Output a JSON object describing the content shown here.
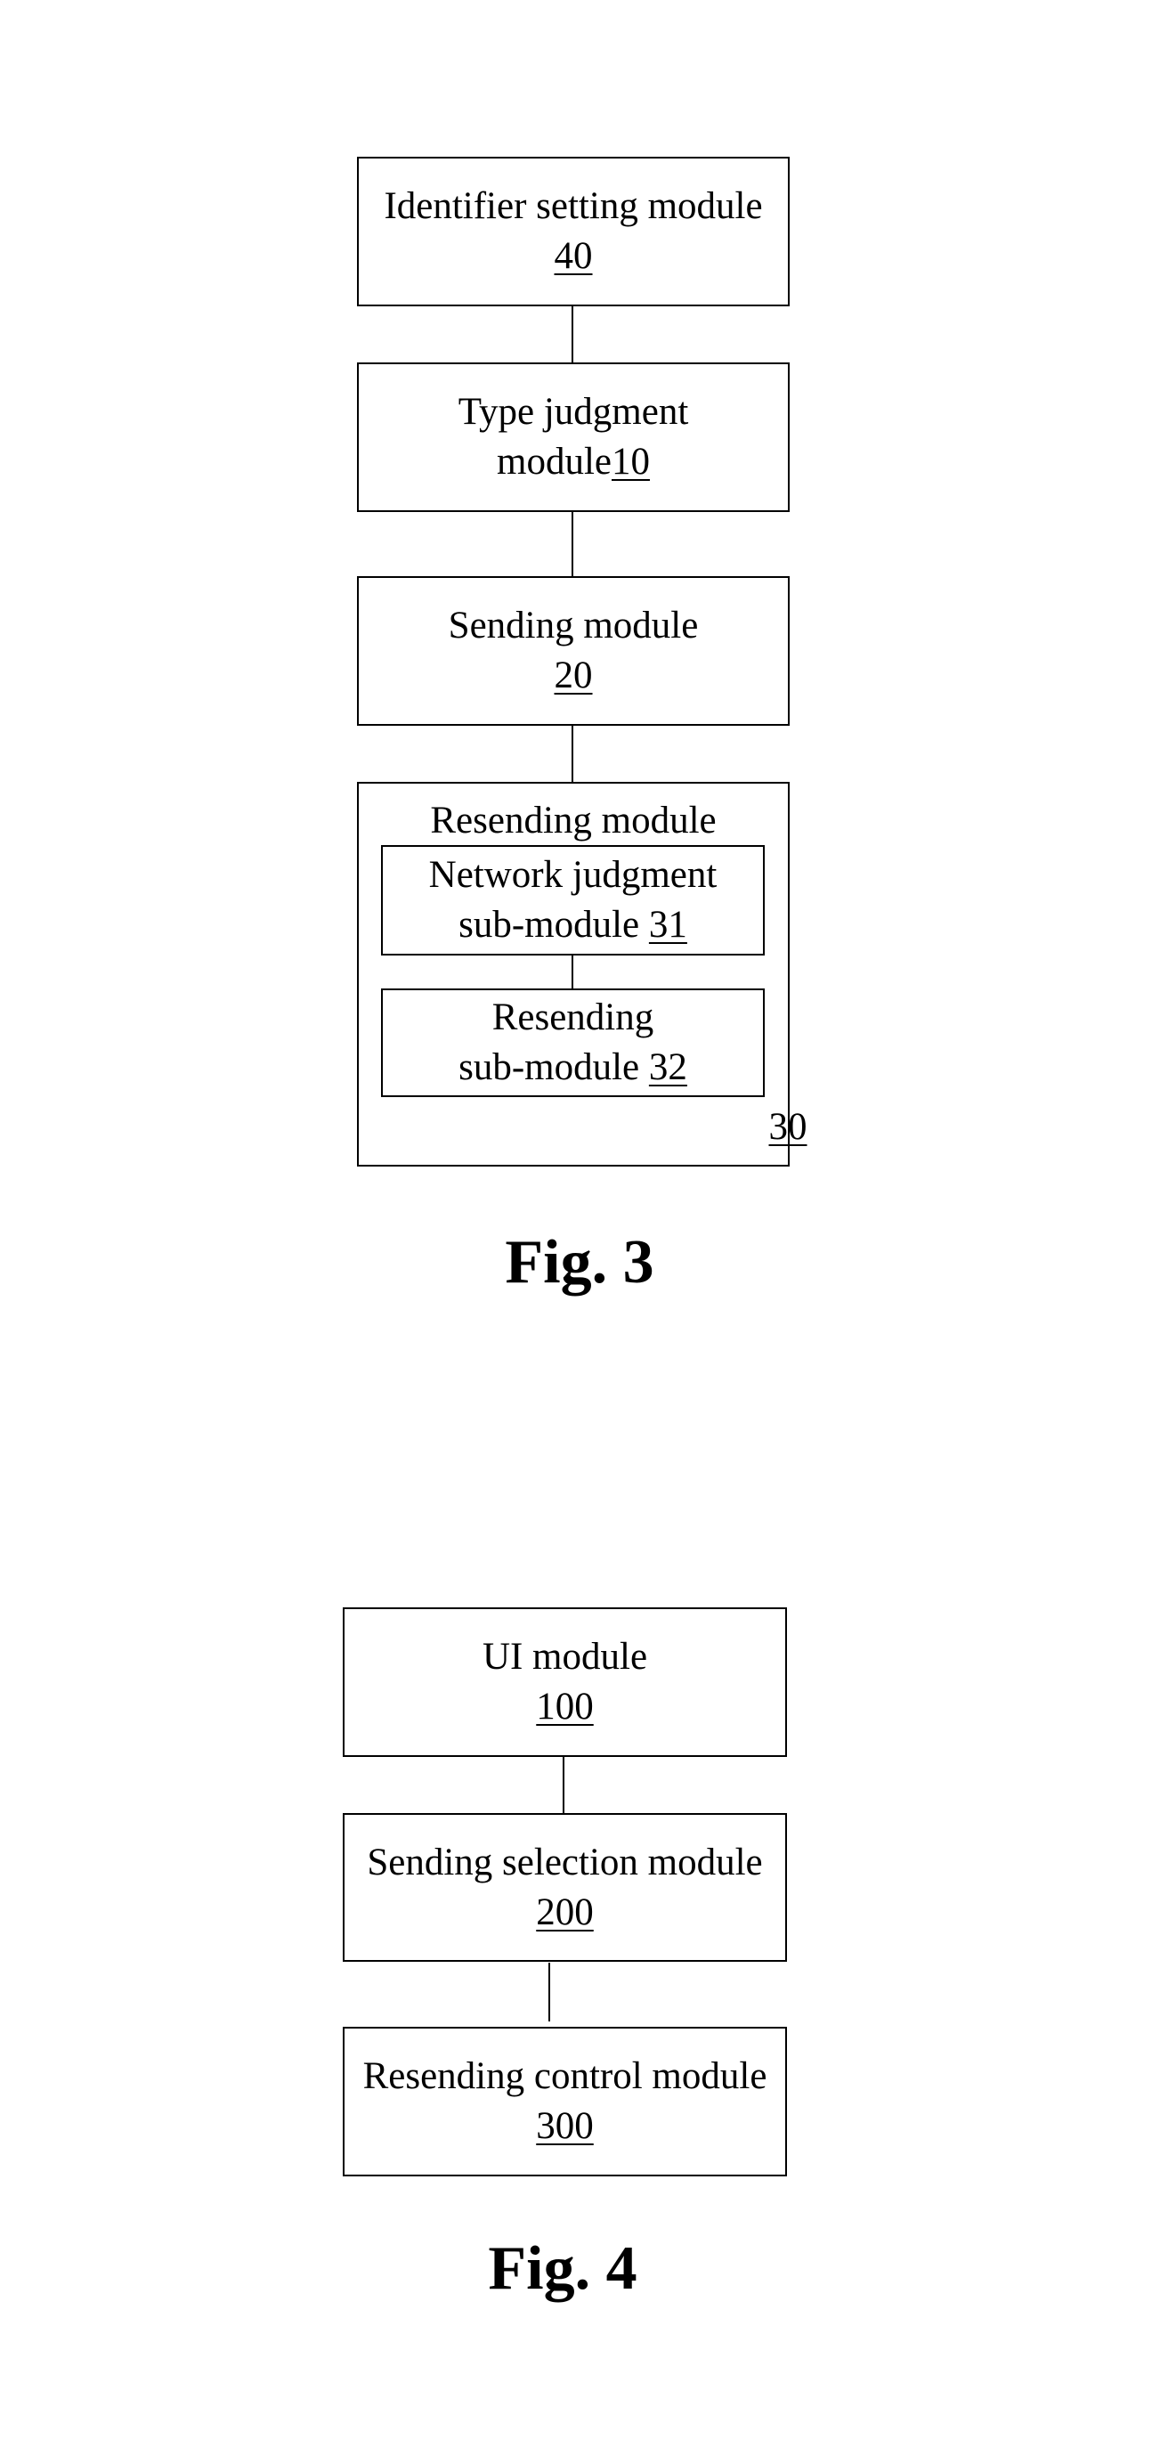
{
  "figures": [
    {
      "caption": "Fig. 3",
      "blocks": [
        {
          "lines": [
            "Identifier setting module"
          ],
          "ref": "40",
          "ref_inline": false
        },
        {
          "lines": [
            "Type judgment"
          ],
          "line2_prefix": "module",
          "ref": "10",
          "ref_inline": true
        },
        {
          "lines": [
            "Sending module"
          ],
          "ref": "20",
          "ref_inline": false
        },
        {
          "title": "Resending module",
          "ref": "30",
          "children": [
            {
              "line1": "Network judgment",
              "line2_prefix": "sub-module ",
              "ref": "31"
            },
            {
              "line1": "Resending",
              "line2_prefix": "sub-module ",
              "ref": "32"
            }
          ]
        }
      ]
    },
    {
      "caption": "Fig. 4",
      "blocks": [
        {
          "lines": [
            "UI module"
          ],
          "ref": "100"
        },
        {
          "lines": [
            "Sending selection module"
          ],
          "ref": "200"
        },
        {
          "lines": [
            "Resending control module"
          ],
          "ref": "300"
        }
      ]
    }
  ]
}
